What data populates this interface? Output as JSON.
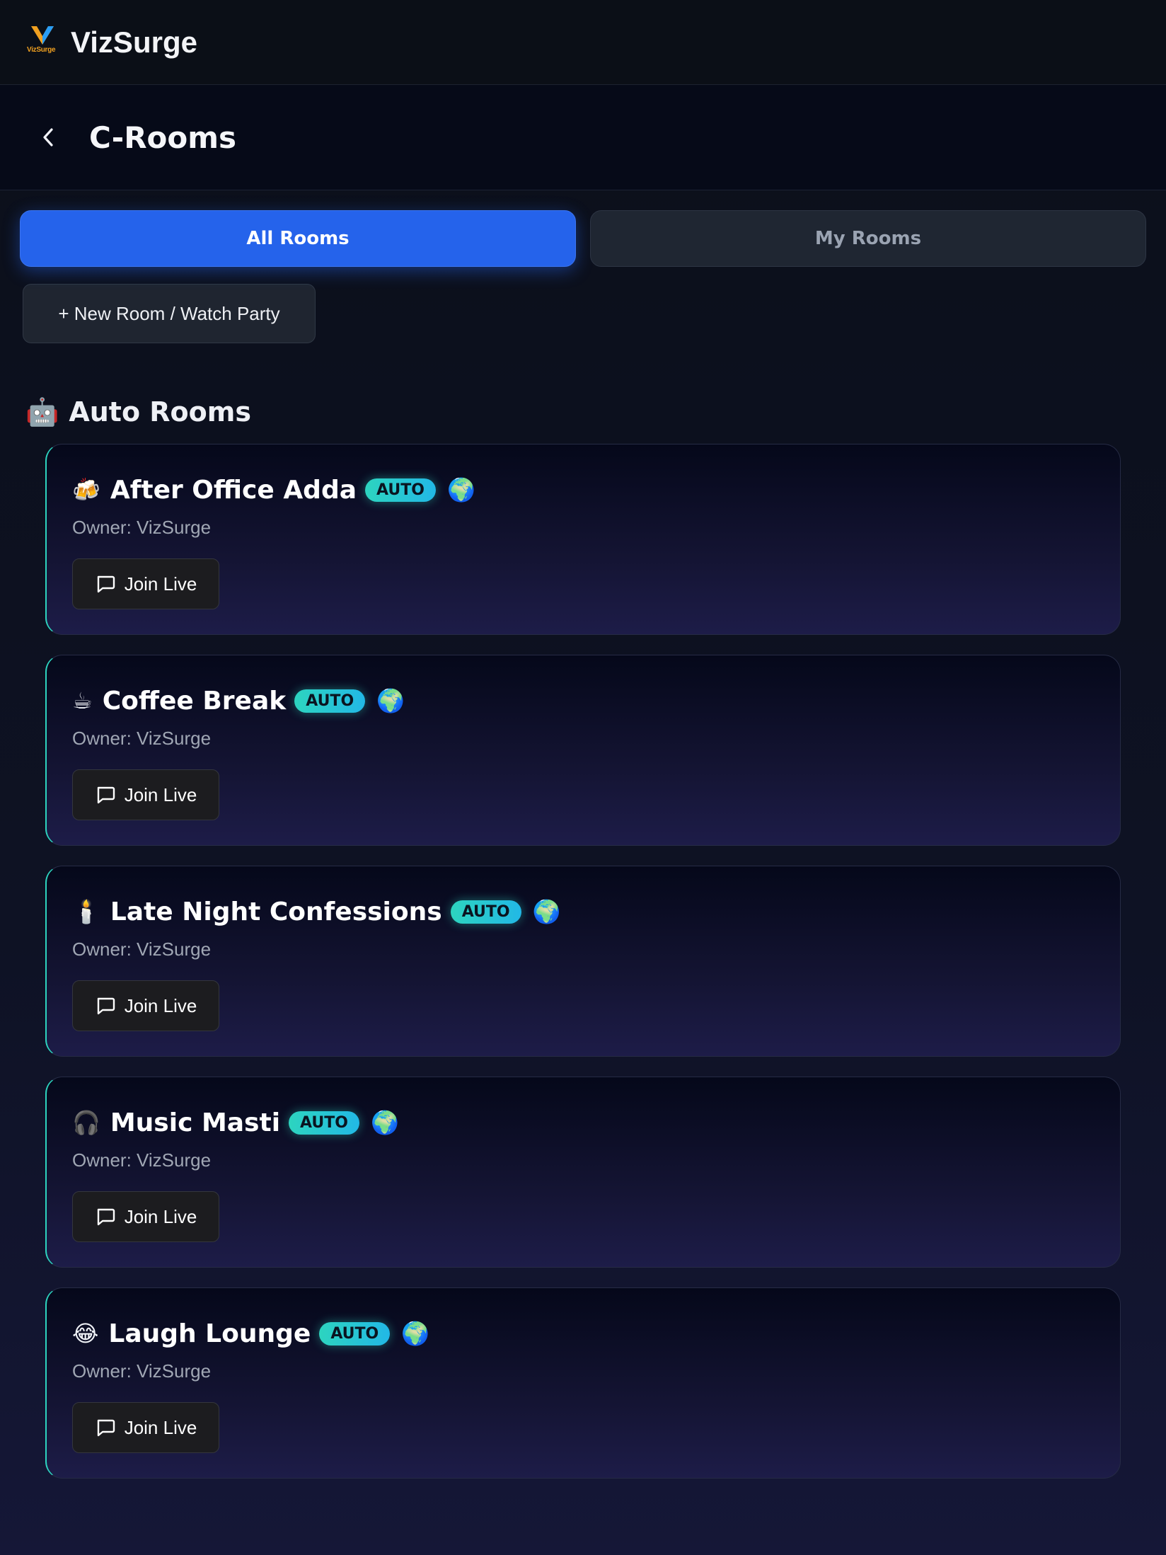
{
  "app": {
    "name": "VizSurge",
    "logo_wordmark": "VizSurge"
  },
  "page": {
    "title": "C-Rooms"
  },
  "tabs": [
    {
      "label": "All Rooms",
      "active": true
    },
    {
      "label": "My Rooms",
      "active": false
    }
  ],
  "actions": {
    "new_room_label": "+ New Room / Watch Party"
  },
  "section": {
    "emoji": "🤖",
    "title": "Auto Rooms"
  },
  "rooms": [
    {
      "emoji": "🍻",
      "name": "After Office Adda",
      "badge": "AUTO",
      "globe": "🌍",
      "owner": "Owner: VizSurge",
      "join_label": "Join Live"
    },
    {
      "emoji": "☕",
      "name": "Coffee Break",
      "badge": "AUTO",
      "globe": "🌍",
      "owner": "Owner: VizSurge",
      "join_label": "Join Live"
    },
    {
      "emoji": "🕯️",
      "name": "Late Night Confessions",
      "badge": "AUTO",
      "globe": "🌍",
      "owner": "Owner: VizSurge",
      "join_label": "Join Live"
    },
    {
      "emoji": "🎧",
      "name": "Music Masti",
      "badge": "AUTO",
      "globe": "🌍",
      "owner": "Owner: VizSurge",
      "join_label": "Join Live"
    },
    {
      "emoji": "😂",
      "name": "Laugh Lounge",
      "badge": "AUTO",
      "globe": "🌍",
      "owner": "Owner: VizSurge",
      "join_label": "Join Live"
    }
  ],
  "colors": {
    "accent": "#2563eb",
    "badge": "#2dd4bf",
    "background": "#0b0f19"
  }
}
